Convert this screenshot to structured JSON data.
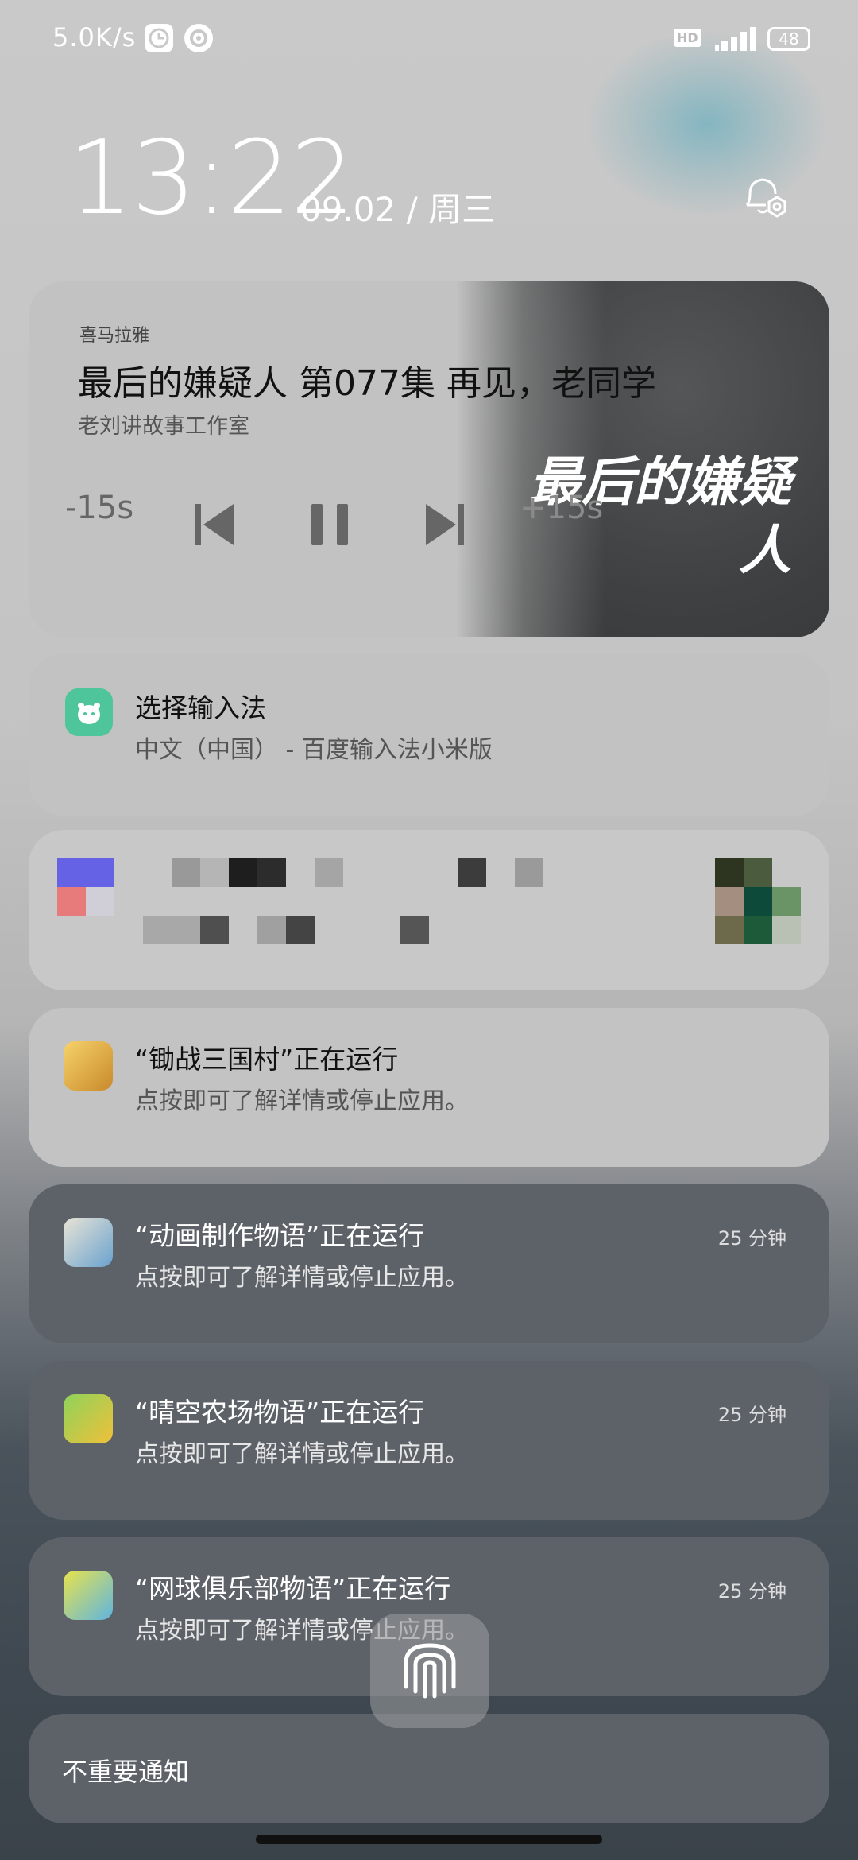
{
  "status_bar": {
    "net_speed": "5.0K/s",
    "hd_label": "HD",
    "battery": "48"
  },
  "lockscreen": {
    "time": "13:22",
    "date": "09.02 / 周三"
  },
  "media_card": {
    "app_name": "喜马拉雅",
    "track_title": "最后的嫌疑人 第077集 再见，老同学",
    "author": "老刘讲故事工作室",
    "rewind_label": "-15s",
    "forward_label": "+15s",
    "art_title": "最后的嫌疑人"
  },
  "ime_card": {
    "title": "选择输入法",
    "subtitle": "中文（中国） - 百度输入法小米版"
  },
  "running": [
    {
      "title": "“锄战三国村”正在运行",
      "subtitle": "点按即可了解详情或停止应用。",
      "time": ""
    },
    {
      "title": "“动画制作物语”正在运行",
      "subtitle": "点按即可了解详情或停止应用。",
      "time": "25 分钟"
    },
    {
      "title": "“晴空农场物语”正在运行",
      "subtitle": "点按即可了解详情或停止应用。",
      "time": "25 分钟"
    },
    {
      "title": "“网球俱乐部物语”正在运行",
      "subtitle": "点按即可了解详情或停止应用。",
      "time": "25 分钟"
    }
  ],
  "unimportant": {
    "label": "不重要通知"
  },
  "colors": {
    "ime_icon": "#4fc59b",
    "card_light": "#c2c2c2",
    "card_dark": "#5d6269"
  }
}
